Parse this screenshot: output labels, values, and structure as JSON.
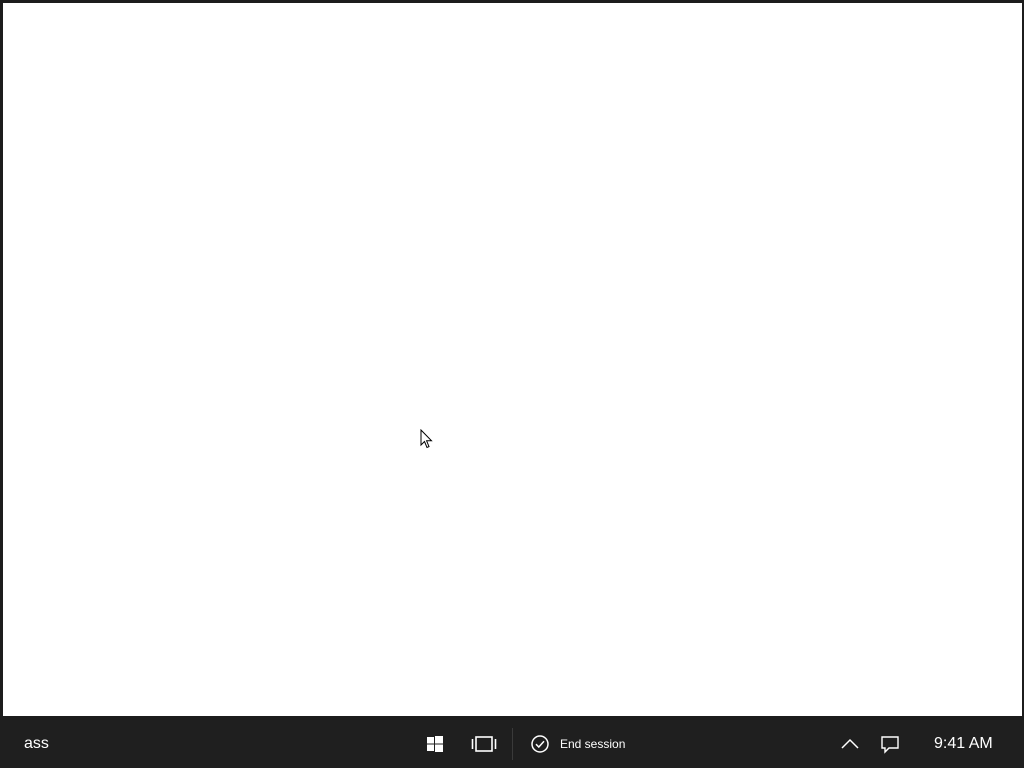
{
  "taskbar": {
    "app_label": "ass",
    "end_session_label": "End session",
    "clock": "9:41 AM",
    "icons": {
      "start": "windows-logo-icon",
      "task_view": "task-view-icon",
      "end_session": "check-circle-icon",
      "tray_chevron": "chevron-up-icon",
      "notifications": "action-center-icon"
    }
  },
  "colors": {
    "taskbar_bg": "#1f1f1f",
    "window_bg": "#ffffff",
    "text": "#ffffff"
  }
}
